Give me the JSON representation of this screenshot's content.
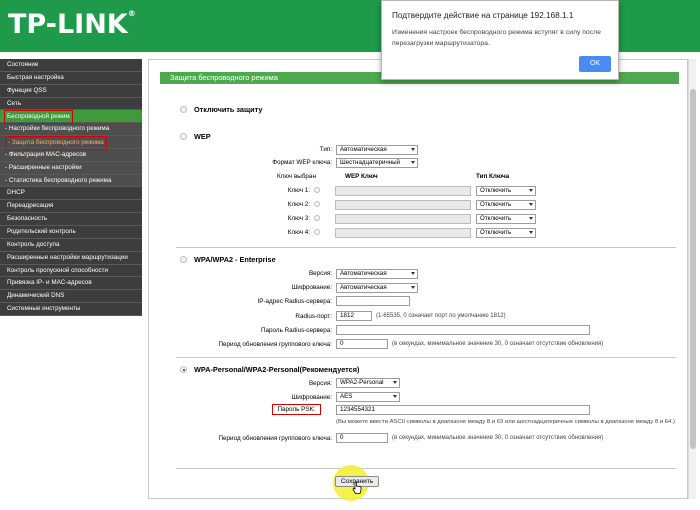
{
  "header": {
    "logo": "TP-LINK",
    "logo_mark": "®"
  },
  "sidebar": {
    "items": [
      {
        "label": "Состояние"
      },
      {
        "label": "Быстрая настройка"
      },
      {
        "label": "Функция QSS"
      },
      {
        "label": "Сеть"
      },
      {
        "label": "Беспроводной режим"
      },
      {
        "label": "- Настройки беспроводного режима"
      },
      {
        "label": "- Защита беспроводного режима"
      },
      {
        "label": "- Фильтрация MAC-адресов"
      },
      {
        "label": "- Расширенные настройки"
      },
      {
        "label": "- Статистика беспроводного режима"
      },
      {
        "label": "DHCP"
      },
      {
        "label": "Переадресация"
      },
      {
        "label": "Безопасность"
      },
      {
        "label": "Родительский контроль"
      },
      {
        "label": "Контроль доступа"
      },
      {
        "label": "Расширенные настройки маршрутизации"
      },
      {
        "label": "Контроль пропускной способности"
      },
      {
        "label": "Привязка IP- и MAC-адресов"
      },
      {
        "label": "Динамический DNS"
      },
      {
        "label": "Системные инструменты"
      }
    ]
  },
  "panel": {
    "title": "Защита беспроводного режима"
  },
  "disable": {
    "label": "Отключить защиту"
  },
  "wep": {
    "title": "WEP",
    "type_label": "Тип:",
    "type_value": "Автоматическая",
    "format_label": "Формат WEP ключа:",
    "format_value": "Шестнадцатеричный",
    "col_selected": "Ключ выбран",
    "col_key": "WEP Ключ",
    "col_type": "Тип Ключа",
    "keys": [
      {
        "label": "Ключ 1:",
        "type": "Отключить"
      },
      {
        "label": "Ключ 2:",
        "type": "Отключить"
      },
      {
        "label": "Ключ 3:",
        "type": "Отключить"
      },
      {
        "label": "Ключ 4:",
        "type": "Отключить"
      }
    ]
  },
  "enterprise": {
    "title": "WPA/WPA2 - Enterprise",
    "version_label": "Версия:",
    "version_value": "Автоматическая",
    "encryption_label": "Шифрование:",
    "encryption_value": "Автоматическая",
    "radius_ip_label": "IP-адрес Radius-сервера:",
    "radius_ip_value": "",
    "radius_port_label": "Radius-порт:",
    "radius_port_value": "1812",
    "radius_port_hint": "(1-65535, 0 означает порт по умолчанию 1812)",
    "radius_password_label": "Пароль Radius-сервера:",
    "radius_password_value": "",
    "group_key_label": "Период обновления группового ключа:",
    "group_key_value": "0",
    "group_key_hint": "(в секундах, минимальное значение 30, 0 означает отсутствие обновления)"
  },
  "personal": {
    "title": "WPA-Personal/WPA2-Personal(Рекомендуется)",
    "version_label": "Версия:",
    "version_value": "WPA2-Personal",
    "encryption_label": "Шифрование:",
    "encryption_value": "AES",
    "psk_label": "Пароль PSK:",
    "psk_value": "1234554321",
    "psk_hint": "(Вы можете ввести ASCII символы в диапазоне между 8 и 63 или шестнадцатеричные символы в диапазоне между 8 и 64.)",
    "group_key_label": "Период обновления группового ключа:",
    "group_key_value": "0",
    "group_key_hint": "(в секундах, минимальное значение 30, 0 означает отсутствие обновления)"
  },
  "actions": {
    "save_label": "Сохранить"
  },
  "dialog": {
    "title": "Подтвердите действие на странице 192.168.1.1",
    "message_line1": "Изменения настроек беспроводного режима вступят в силу после",
    "message_line2": "перезагрузки маршрутизатора.",
    "ok_label": "OK"
  },
  "colors": {
    "header_green": "#1f9a4a",
    "panel_green": "#4ea94e",
    "sidebar_dark": "#3d3d3d",
    "highlight_red": "#d40000",
    "dialog_button": "#4a8af4"
  }
}
